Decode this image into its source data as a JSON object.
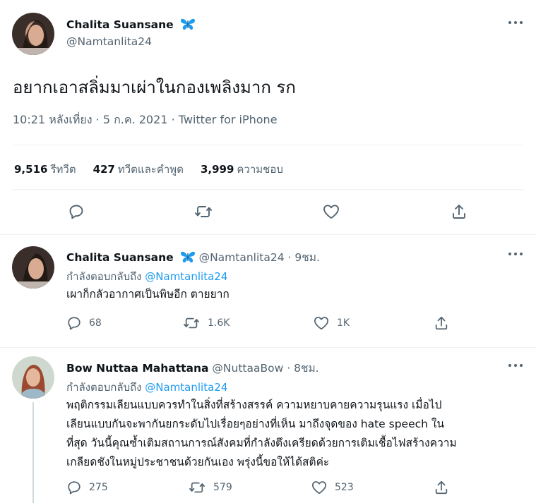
{
  "main_tweet": {
    "author_name": "Chalita Suansane",
    "author_handle": "@Namtanlita24",
    "text": "อยากเอาสลิ่มมาเผ่าในกองเพลิงมาก รก",
    "time": "10:21 หลังเที่ยง",
    "date": "5 ก.ค. 2021",
    "source": "Twitter for iPhone",
    "retweets_count": "9,516",
    "retweets_label": "รีทวีต",
    "quotes_count": "427",
    "quotes_label": "ทวีตและคำพูด",
    "likes_count": "3,999",
    "likes_label": "ความชอบ"
  },
  "replies": [
    {
      "author_name": "Chalita Suansane",
      "author_handle": "@Namtanlita24",
      "age": "· 9ชม.",
      "reply_prefix": "กำลังตอบกลับถึง",
      "reply_to": "@Namtanlita24",
      "text": "เผาก็กลัวอากาศเป็นพิษอีก ตายยาก",
      "reply_count": "68",
      "retweet_count": "1.6K",
      "like_count": "1K"
    },
    {
      "author_name": "Bow Nuttaa Mahattana",
      "author_handle": "@NuttaaBow",
      "age": "· 8ชม.",
      "reply_prefix": "กำลังตอบกลับถึง",
      "reply_to": "@Namtanlita24",
      "text_lines": [
        "พฤติกรรมเลียนแบบควรทำในสิ่งที่สร้างสรรค์ ความหยาบคายความรุนแรง เมื่อไป",
        "เลียนแบบกันจะพากันยกระดับไปเรื่อยๆอย่างที่เห็น มาถึงจุดของ hate speech ใน",
        "ที่สุด วันนี้คุณซ้ำเติมสถานการณ์สังคมที่กำลังตึงเครียดด้วยการเติมเชื้อไฟสร้างความ",
        "เกลียดชังในหมู่ประชาชนด้วยกันเอง พรุ่งนี้ขอให้ได้สติค่ะ"
      ],
      "reply_count": "275",
      "retweet_count": "579",
      "like_count": "523"
    }
  ],
  "colors": {
    "text_primary": "#0f1419",
    "text_secondary": "#536471",
    "link": "#1d9bf0",
    "badge": "#1d9bf0",
    "divider": "#eff3f4"
  },
  "icons": {
    "badge": "butterfly-icon",
    "reply": "comment-icon",
    "retweet": "retweet-icon",
    "like": "heart-icon",
    "share": "share-icon",
    "more": "more-icon"
  }
}
